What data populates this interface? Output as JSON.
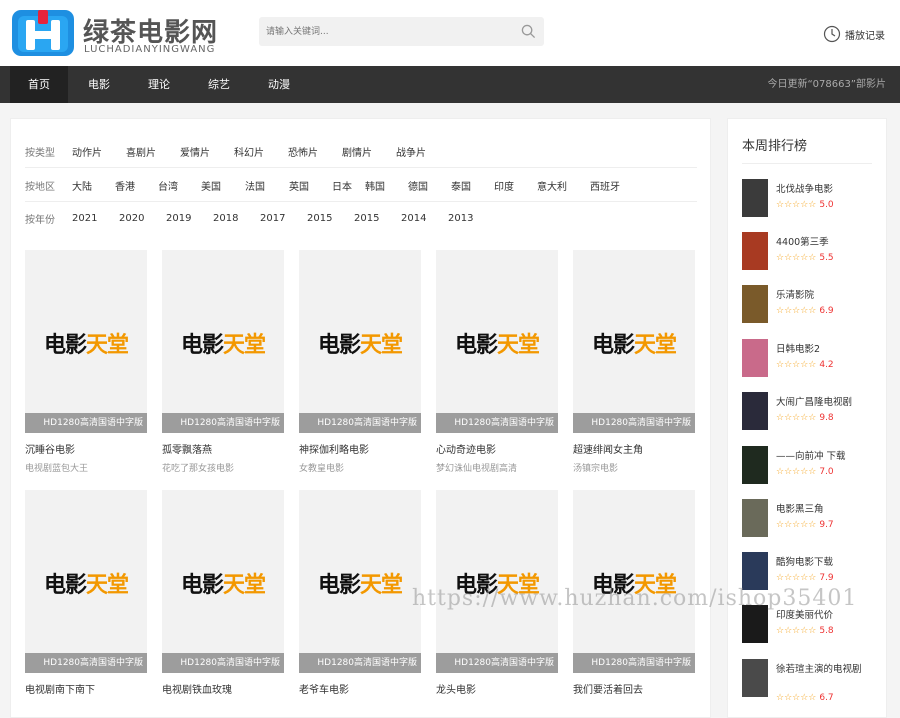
{
  "brand": {
    "title": "绿茶电影网",
    "subtitle": "LUCHADIANYINGWANG"
  },
  "search": {
    "placeholder": "请输入关键词..."
  },
  "history": {
    "label": "播放记录"
  },
  "nav": {
    "items": [
      "首页",
      "电影",
      "理论",
      "综艺",
      "动漫"
    ],
    "active": "首页",
    "update_text": "今日更新“078663”部影片"
  },
  "filters": [
    {
      "label": "按类型",
      "options": [
        "动作片",
        "喜剧片",
        "爱情片",
        "科幻片",
        "恐怖片",
        "剧情片",
        "战争片"
      ]
    },
    {
      "label": "按地区",
      "options": [
        "大陆",
        "香港",
        "台湾",
        "美国",
        "法国",
        "英国",
        "日本",
        "韩国",
        "德国",
        "泰国",
        "印度",
        "意大利",
        "西班牙"
      ]
    },
    {
      "label": "按年份",
      "options": [
        "2021",
        "2020",
        "2019",
        "2018",
        "2017",
        "2015",
        "2015",
        "2014",
        "2013"
      ]
    }
  ],
  "poster": {
    "logo_black": "电影",
    "logo_orange": "天堂",
    "badge": "HD1280高清国语中字版"
  },
  "movies": [
    {
      "title": "沉睡谷电影",
      "sub": "电视剧蓝包大王"
    },
    {
      "title": "孤零飘落燕",
      "sub": "花吃了那女孩电影"
    },
    {
      "title": "神探伽利略电影",
      "sub": "女教皇电影"
    },
    {
      "title": "心动奇迹电影",
      "sub": "梦幻诛仙电视剧高清"
    },
    {
      "title": "超速绯闻女主角",
      "sub": "汤镇宗电影"
    },
    {
      "title": "电视剧南下南下",
      "sub": ""
    },
    {
      "title": "电视剧铁血玫瑰",
      "sub": ""
    },
    {
      "title": "老爷车电影",
      "sub": ""
    },
    {
      "title": "龙头电影",
      "sub": ""
    },
    {
      "title": "我们要活着回去",
      "sub": ""
    }
  ],
  "ranking": {
    "title": "本周排行榜",
    "stars": "☆☆☆☆☆",
    "items": [
      {
        "name": "北伐战争电影",
        "score": "5.0"
      },
      {
        "name": "4400第三季",
        "score": "5.5"
      },
      {
        "name": "乐清影院",
        "score": "6.9"
      },
      {
        "name": "日韩电影2",
        "score": "4.2"
      },
      {
        "name": "大闹广昌隆电视剧",
        "score": "9.8"
      },
      {
        "name": "——向前冲 下载",
        "score": "7.0"
      },
      {
        "name": "电影黑三角",
        "score": "9.7"
      },
      {
        "name": "酷狗电影下载",
        "score": "7.9"
      },
      {
        "name": "印度美丽代价",
        "score": "5.8"
      },
      {
        "name": "徐若瑄主演的电视剧",
        "score": "6.7"
      }
    ]
  },
  "watermark": "https://www.huzhan.com/ishop35401",
  "colors": {
    "nav_bg": "#333333",
    "accent_orange": "#f39800",
    "score_red": "#ee3333",
    "star": "#f5a623"
  }
}
